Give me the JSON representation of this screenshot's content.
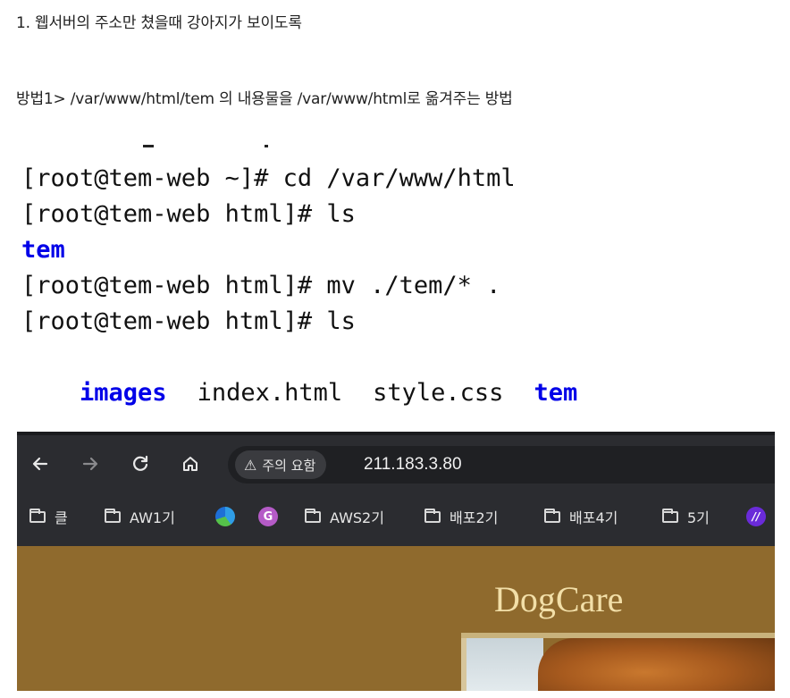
{
  "document": {
    "line1": "1. 웹서버의 주소만 쳤을때 강아지가 보이도록",
    "line2": "방법1> /var/www/html/tem 의 내용물을 /var/www/html로 옮겨주는 방법"
  },
  "terminal": {
    "lines": [
      "[root@tem-web ~]# cd /var/www/html",
      "[root@tem-web html]# ls",
      "tem",
      "[root@tem-web html]# mv ./tem/* .",
      "[root@tem-web html]# ls"
    ],
    "ls_output": [
      "images",
      "index.html",
      "style.css",
      "tem"
    ]
  },
  "browser": {
    "warning_label": "주의 요함",
    "url": "211.183.3.80",
    "icons": {
      "back": "arrow-left-icon",
      "forward": "arrow-right-icon",
      "reload": "reload-icon",
      "home": "home-icon",
      "warning": "warning-triangle-icon"
    },
    "bookmarks": [
      {
        "type": "folder",
        "label": "클"
      },
      {
        "type": "folder",
        "label": "AW1기"
      },
      {
        "type": "app",
        "icon": "edge-icon"
      },
      {
        "type": "app",
        "icon": "g-icon",
        "glyph": "G"
      },
      {
        "type": "folder",
        "label": "AWS2기"
      },
      {
        "type": "folder",
        "label": "배포2기"
      },
      {
        "type": "folder",
        "label": "배포4기"
      },
      {
        "type": "folder",
        "label": "5기"
      },
      {
        "type": "app",
        "icon": "slash-icon",
        "glyph": "//"
      }
    ],
    "page": {
      "title": "DogCare",
      "background": "#8f6a2d",
      "title_color": "#f2dfa8"
    }
  },
  "colors": {
    "terminal_blue": "#0000e8",
    "browser_chrome": "#2b2c30"
  }
}
